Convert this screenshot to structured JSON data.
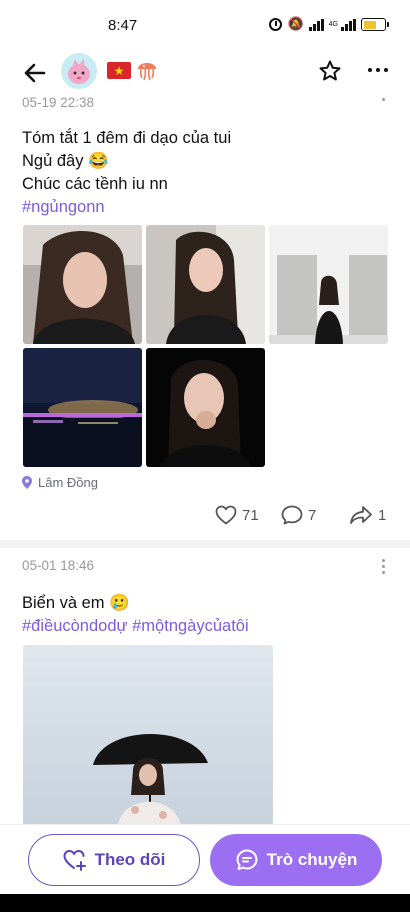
{
  "status_bar": {
    "time": "8:47",
    "network_label": "4G",
    "battery_level": 0.6
  },
  "header": {
    "avatar": "pink-creature-avatar",
    "badges": [
      "vietnam-flag",
      "jellyfish"
    ],
    "actions": [
      "star-icon",
      "more-icon"
    ]
  },
  "posts": [
    {
      "timestamp": "05-19 22:38",
      "lines": [
        "Tóm tắt 1 đêm đi dạo của tui",
        "Ngủ đây 😂",
        "Chúc các tềnh iu nn"
      ],
      "hashtags": "#ngủngonn",
      "location": "Lâm Đồng",
      "likes": "71",
      "comments": "7",
      "shares": "1"
    },
    {
      "timestamp": "05-01 18:46",
      "lines": [
        "Biển và em 🥲"
      ],
      "hashtags": "#điềucòndodự #mộtngàycủatôi"
    }
  ],
  "bottom_bar": {
    "follow_label": "Theo dõi",
    "chat_label": "Trò chuyện"
  },
  "colors": {
    "accent": "#9b6ef2",
    "hashtag": "#7b5ce0",
    "flag_red": "#d8262b"
  }
}
